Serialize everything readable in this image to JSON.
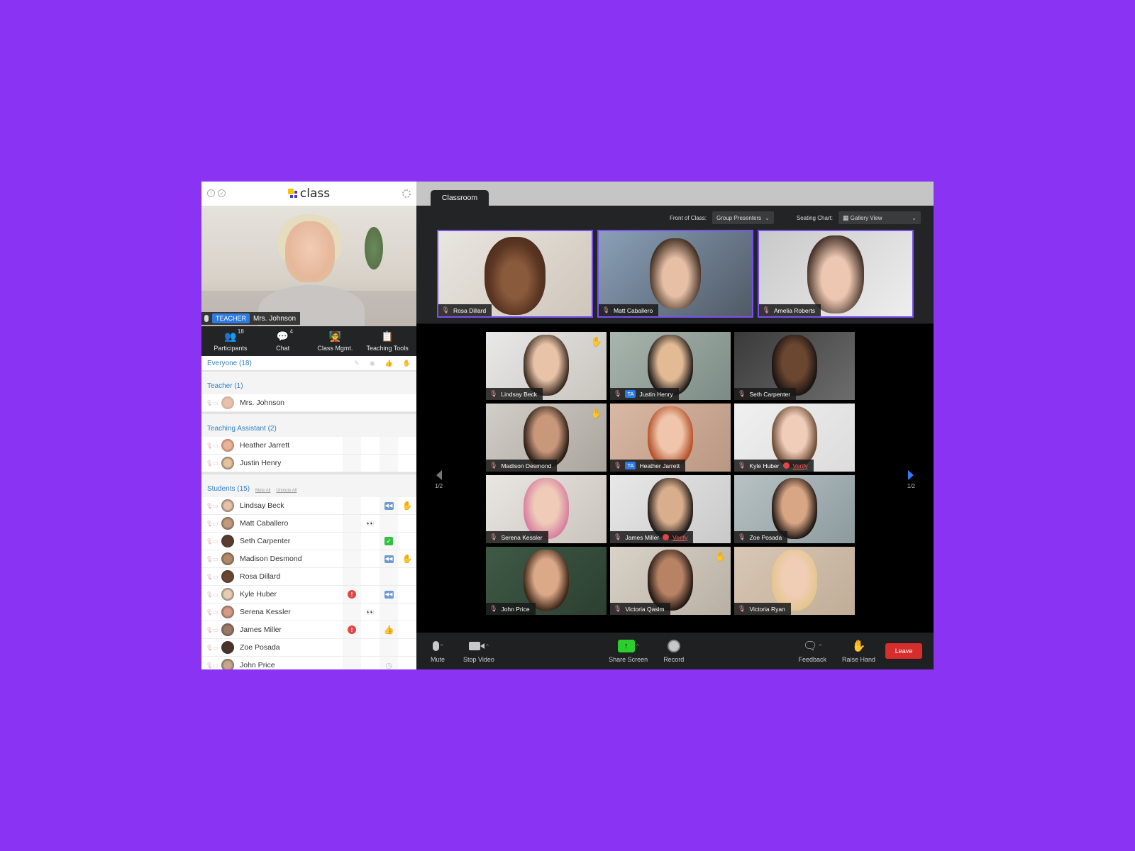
{
  "colors": {
    "background": "#8a33f2",
    "accent_blue": "#2f7fc6",
    "leave_red": "#d62d2d",
    "share_green": "#2ccd2e",
    "front_border": "#7a4ff0"
  },
  "app": {
    "logo_text": "class"
  },
  "teacher_video": {
    "badge": "TEACHER",
    "name": "Mrs. Johnson"
  },
  "tabs": [
    {
      "label": "Participants",
      "count": "18",
      "icon": "participants-icon"
    },
    {
      "label": "Chat",
      "count": "4",
      "icon": "chat-icon"
    },
    {
      "label": "Class Mgmt.",
      "count": "",
      "icon": "class-mgmt-icon"
    },
    {
      "label": "Teaching Tools",
      "count": "",
      "icon": "clipboard-icon"
    }
  ],
  "participants": {
    "everyone_label": "Everyone (18)",
    "teacher_group": {
      "label": "Teacher (1)",
      "members": [
        {
          "name": "Mrs. Johnson"
        }
      ]
    },
    "ta_group": {
      "label": "Teaching Assistant (2)",
      "members": [
        {
          "name": "Heather Jarrett"
        },
        {
          "name": "Justin Henry"
        }
      ]
    },
    "students_group": {
      "label": "Students (15)",
      "mute_all": "Mute All",
      "unmute_all": "Unmute All",
      "members": [
        {
          "name": "Lindsay Beck",
          "status": [
            "rewind",
            "hand"
          ]
        },
        {
          "name": "Matt Caballero",
          "status": [
            "eyes"
          ]
        },
        {
          "name": "Seth Carpenter",
          "status": [
            "check"
          ]
        },
        {
          "name": "Madison Desmond",
          "status": [
            "rewind",
            "hand"
          ]
        },
        {
          "name": "Rosa Dillard",
          "status": []
        },
        {
          "name": "Kyle Huber",
          "status": [
            "alert",
            "rewind"
          ]
        },
        {
          "name": "Serena Kessler",
          "status": [
            "eyes"
          ]
        },
        {
          "name": "James Miller",
          "status": [
            "alert",
            "thumbs-up"
          ]
        },
        {
          "name": "Zoe Posada",
          "status": []
        },
        {
          "name": "John Price",
          "status": [
            "clock"
          ]
        }
      ]
    }
  },
  "classroom": {
    "tab_label": "Classroom",
    "front_of_class_label": "Front of Class:",
    "front_of_class_value": "Group Presenters",
    "seating_chart_label": "Seating Chart:",
    "seating_chart_value": "Gallery View",
    "front_tiles": [
      {
        "name": "Rosa Dillard"
      },
      {
        "name": "Matt Caballero"
      },
      {
        "name": "Amelia Roberts"
      }
    ],
    "gallery": [
      {
        "name": "Lindsay Beck",
        "ta": false,
        "verify": false,
        "hand": true
      },
      {
        "name": "Justin Henry",
        "ta": true,
        "verify": false,
        "hand": false
      },
      {
        "name": "Seth Carpenter",
        "ta": false,
        "verify": false,
        "hand": false
      },
      {
        "name": "Madison Desmond",
        "ta": false,
        "verify": false,
        "hand": true
      },
      {
        "name": "Heather Jarrett",
        "ta": true,
        "verify": false,
        "hand": false
      },
      {
        "name": "Kyle Huber",
        "ta": false,
        "verify": true,
        "hand": false
      },
      {
        "name": "Serena Kessler",
        "ta": false,
        "verify": false,
        "hand": false
      },
      {
        "name": "James Miller",
        "ta": false,
        "verify": true,
        "hand": false
      },
      {
        "name": "Zoe Posada",
        "ta": false,
        "verify": false,
        "hand": false
      },
      {
        "name": "John Price",
        "ta": false,
        "verify": false,
        "hand": false
      },
      {
        "name": "Victoria Qasim",
        "ta": false,
        "verify": false,
        "hand": true
      },
      {
        "name": "Victoria Ryan",
        "ta": false,
        "verify": false,
        "hand": false
      }
    ],
    "ta_badge": "TA",
    "verify_label": "Verify",
    "page_left": "1/2",
    "page_right": "1/2"
  },
  "toolbar": {
    "mute": "Mute",
    "stop_video": "Stop Video",
    "share_screen": "Share Screen",
    "record": "Record",
    "feedback": "Feedback",
    "raise_hand": "Raise Hand",
    "leave": "Leave"
  }
}
